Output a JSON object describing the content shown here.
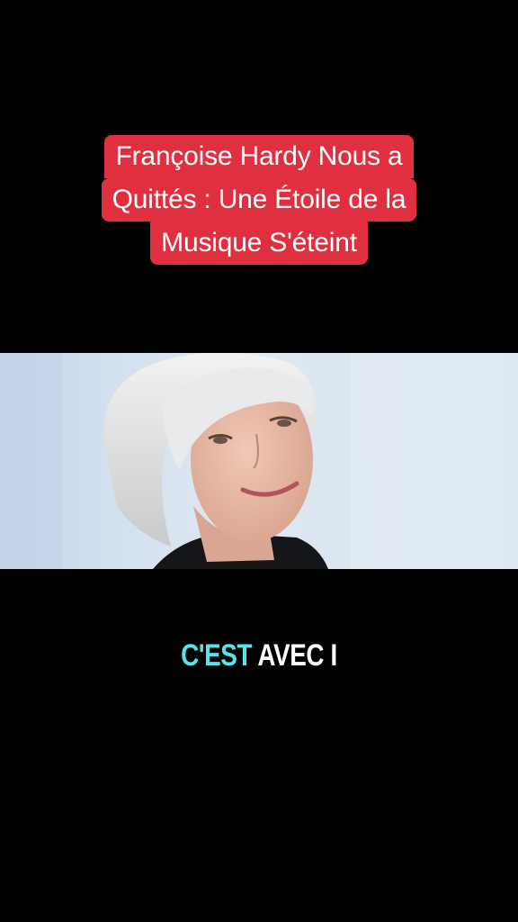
{
  "title": {
    "lines": [
      "Françoise Hardy Nous a",
      "Quittés : Une Étoile de la",
      "Musique S'éteint"
    ],
    "background_color": "#e0303f",
    "text_color": "#ffffff"
  },
  "photo": {
    "subject": "portrait-photo"
  },
  "subtitle": {
    "highlighted": "C'EST",
    "rest": "AVEC I",
    "highlight_color": "#56e4ea",
    "text_color": "#ffffff"
  }
}
